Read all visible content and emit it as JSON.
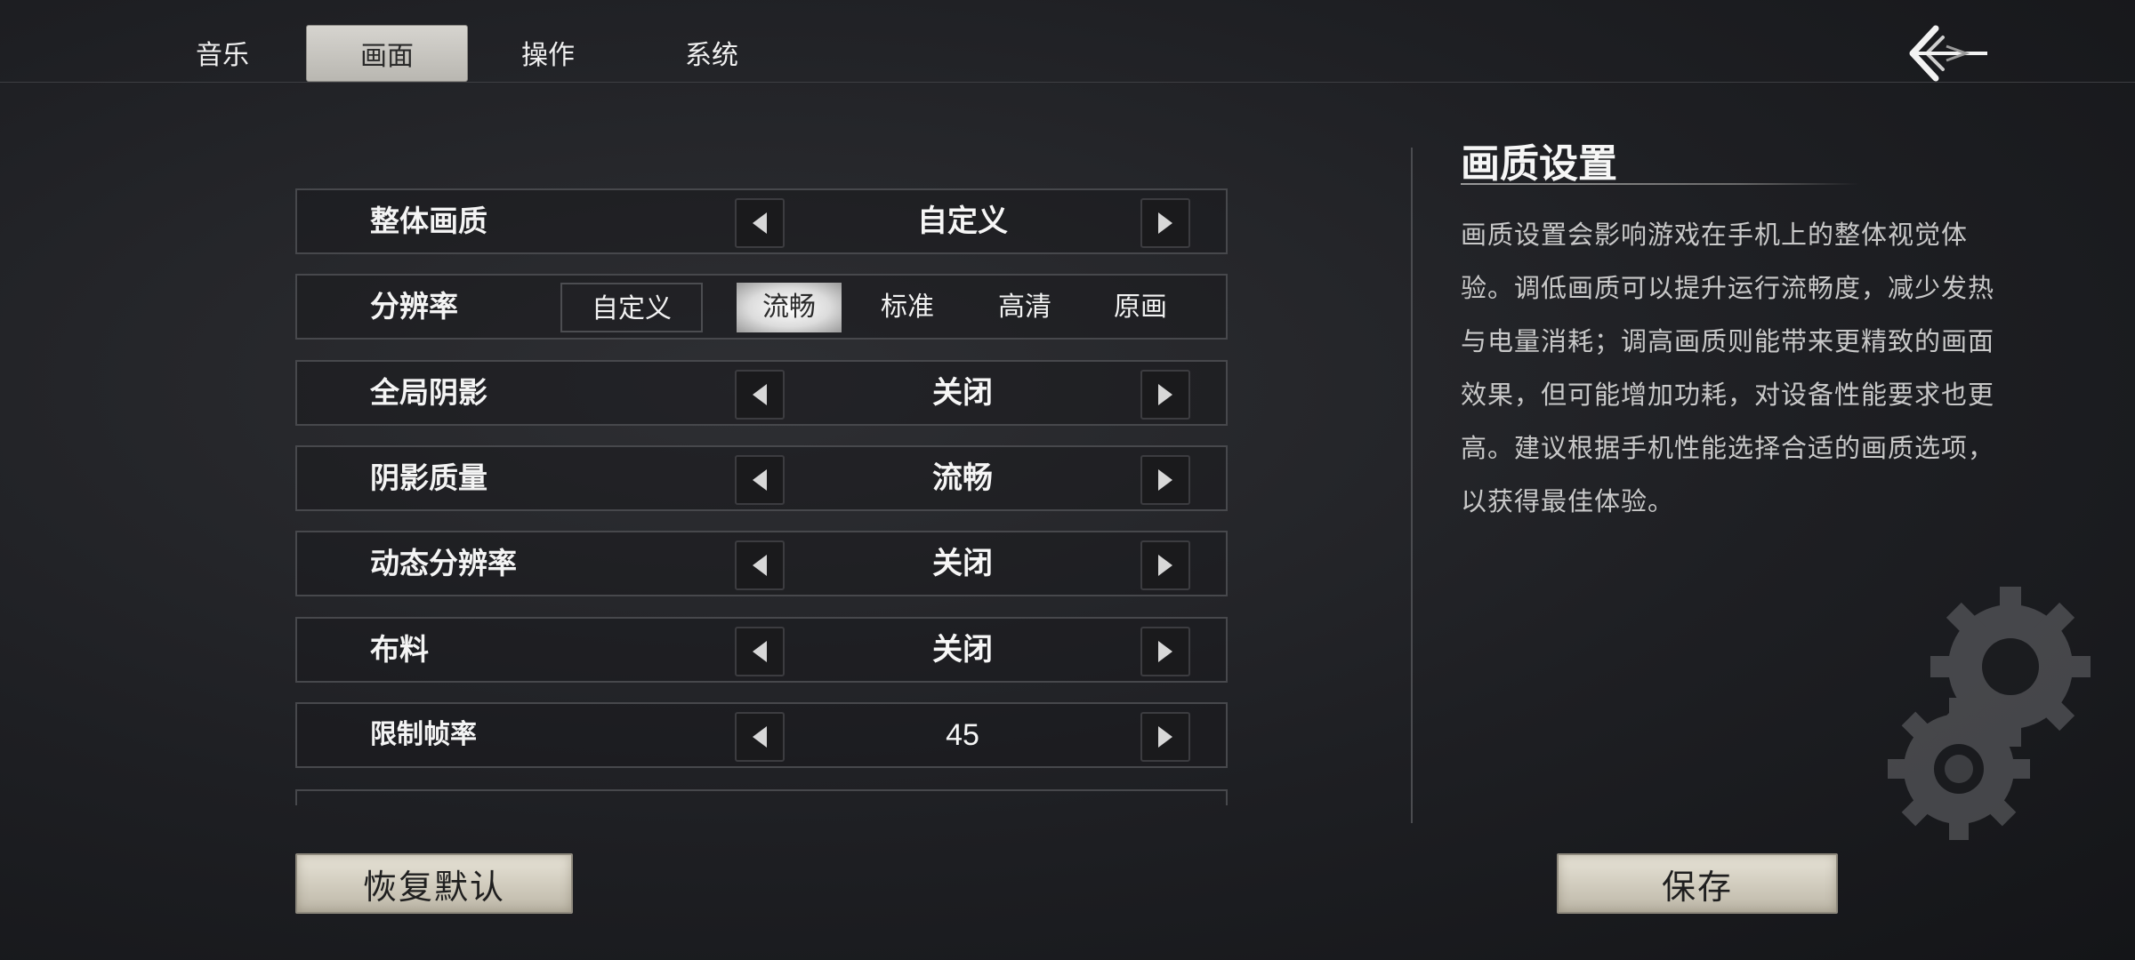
{
  "tabs": [
    {
      "label": "音乐",
      "active": false
    },
    {
      "label": "画面",
      "active": true
    },
    {
      "label": "操作",
      "active": false
    },
    {
      "label": "系统",
      "active": false
    }
  ],
  "settings": {
    "overall_quality": {
      "label": "整体画质",
      "value": "自定义"
    },
    "resolution": {
      "label": "分辨率",
      "options": [
        "自定义",
        "流畅",
        "标准",
        "高清",
        "原画"
      ],
      "selected": "流畅"
    },
    "global_shadow": {
      "label": "全局阴影",
      "value": "关闭"
    },
    "shadow_quality": {
      "label": "阴影质量",
      "value": "流畅"
    },
    "dynamic_resolution": {
      "label": "动态分辨率",
      "value": "关闭"
    },
    "cloth": {
      "label": "布料",
      "value": "关闭"
    },
    "frame_limit": {
      "label": "限制帧率",
      "value": "45"
    }
  },
  "info": {
    "title": "画质设置",
    "description": "画质设置会影响游戏在手机上的整体视觉体验。调低画质可以提升运行流畅度，减少发热与电量消耗；调高画质则能带来更精致的画面效果，但可能增加功耗，对设备性能要求也更高。建议根据手机性能选择合适的画质选项，以获得最佳体验。"
  },
  "buttons": {
    "reset": "恢复默认",
    "save": "保存"
  },
  "colors": {
    "selected_tab": "#c9c7c1",
    "accent_button": "#d2cdbf",
    "background": "#1e1f23"
  }
}
